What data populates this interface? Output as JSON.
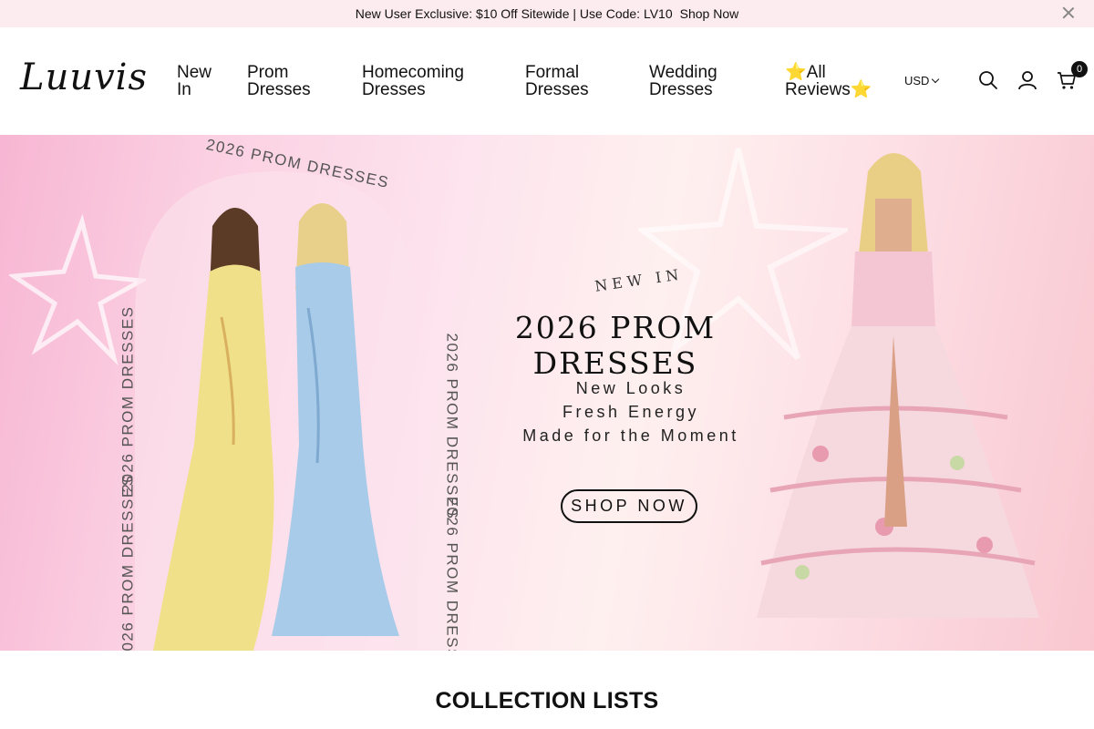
{
  "announcement": {
    "text": "New User Exclusive: $10 Off Sitewide | Use Code: LV10",
    "link": "Shop Now"
  },
  "header": {
    "logo": "Luuvis",
    "nav": [
      {
        "line1": "New",
        "line2": "In"
      },
      {
        "line1": "Prom",
        "line2": "Dresses"
      },
      {
        "line1": "Homecoming",
        "line2": "Dresses"
      },
      {
        "line1": "Formal",
        "line2": "Dresses"
      },
      {
        "line1": "Wedding",
        "line2": "Dresses"
      },
      {
        "line1": "⭐All",
        "line2": "Reviews⭐"
      }
    ],
    "currency": "USD",
    "cart_count": "0"
  },
  "hero": {
    "arch_text": "2026 PROM DRESSES",
    "new_in": "NEW IN",
    "title": "2026 PROM DRESSES",
    "taglines": [
      "New Looks",
      "Fresh Energy",
      "Made for the Moment"
    ],
    "button": "SHOP NOW"
  },
  "section": {
    "title": "COLLECTION LISTS"
  },
  "colors": {
    "announce_bg": "#fcecf0",
    "hero_pink": "#f7b6d3",
    "text": "#111111"
  }
}
